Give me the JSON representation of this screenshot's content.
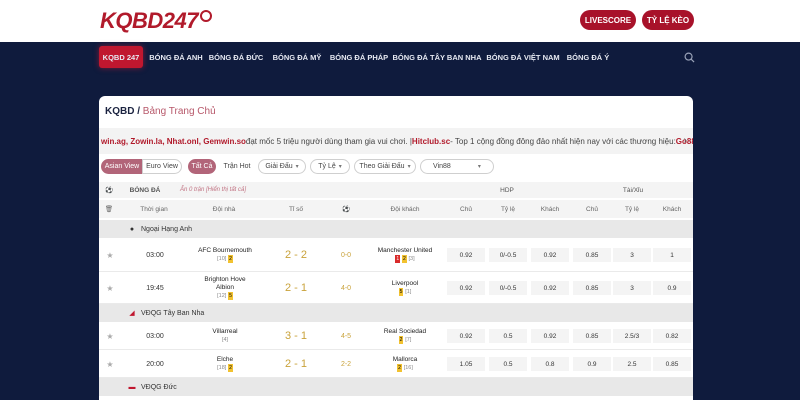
{
  "header": {
    "logo_text": "KQBD247",
    "livescore_label": "LIVESCORE",
    "odds_label": "TỶ LỆ KÈO"
  },
  "nav": {
    "items": [
      {
        "label": "KQBD 247"
      },
      {
        "label": "BÓNG ĐÁ ANH"
      },
      {
        "label": "BÓNG ĐÁ ĐỨC"
      },
      {
        "label": "BÓNG ĐÁ MỸ"
      },
      {
        "label": "BÓNG ĐÁ PHÁP"
      },
      {
        "label": "BÓNG ĐÁ TÂY BAN NHA"
      },
      {
        "label": "BÓNG ĐÁ VIỆT NAM"
      },
      {
        "label": "BÓNG ĐÁ Ý"
      }
    ]
  },
  "breadcrumb": {
    "root": "KQBD",
    "sep": " / ",
    "current": "Bảng Trang Chủ"
  },
  "ticker": {
    "brands": "win.ag, Zowin.la, Nhat.onl, Gemwin.so",
    "text1": " đạt mốc 5 triệu người dùng tham gia vui chơi. | ",
    "brand2": "Hitclub.sc",
    "text2": " - Top 1 cộng đồng đông đảo nhất hiện nay với các thương hiệu: ",
    "brand3": "Go88.l",
    "arrow": "›"
  },
  "filters": {
    "asian_view": "Asian View",
    "euro_view": "Euro View",
    "all": "Tất Cả",
    "hot": "Trận Hot",
    "league": "Giải Đấu",
    "odds_type": "Tỷ Lệ",
    "by_league": "Theo Giải Đấu",
    "bookmaker": "Vin88"
  },
  "table": {
    "sport_label": "BÓNG ĐÁ",
    "hidden_note": "Ẩn 0 trận [Hiển thị tất cả]",
    "hdp": "HDP",
    "taixiu": "Tài/Xỉu",
    "columns": [
      "Thời gian",
      "Đội nhà",
      "Tỉ số",
      "Đội khách",
      "Chủ",
      "Tỷ lệ",
      "Khách",
      "Chủ",
      "Tỷ lệ",
      "Khách"
    ],
    "leagues": [
      {
        "name": "Ngoại Hạng Anh"
      },
      {
        "name": "VĐQG Tây Ban Nha"
      },
      {
        "name": "VĐQG Đức"
      }
    ],
    "matches": [
      {
        "time": "03:00",
        "home": "AFC Bournemouth",
        "home_rank": "[10]",
        "home_card": "2",
        "score": "2 - 2",
        "ht": "0-0",
        "away": "Manchester United",
        "away_rank": "[3]",
        "away_red": "1",
        "away_yellow": "2",
        "hdp_home": "0.92",
        "hdp_line": "0/-0.5",
        "hdp_away": "0.92",
        "ou_over": "0.85",
        "ou_line": "3",
        "ou_under": "1"
      },
      {
        "time": "19:45",
        "home": "Brighton Hove Albion",
        "home_rank": "[12]",
        "home_card": "5",
        "score": "2 - 1",
        "ht": "4-0",
        "away": "Liverpool",
        "away_rank": "[1]",
        "away_card": "5",
        "hdp_home": "0.92",
        "hdp_line": "0/-0.5",
        "hdp_away": "0.92",
        "ou_over": "0.85",
        "ou_line": "3",
        "ou_under": "0.9"
      },
      {
        "time": "03:00",
        "home": "Villarreal",
        "home_rank": "[4]",
        "score": "3 - 1",
        "ht": "4-5",
        "away": "Real Sociedad",
        "away_rank": "[7]",
        "away_card": "2",
        "hdp_home": "0.92",
        "hdp_line": "0.5",
        "hdp_away": "0.92",
        "ou_over": "0.85",
        "ou_line": "2.5/3",
        "ou_under": "0.82"
      },
      {
        "time": "20:00",
        "home": "Elche",
        "home_rank": "[18]",
        "home_card": "2",
        "score": "2 - 1",
        "ht": "2-2",
        "away": "Mallorca",
        "away_rank": "[16]",
        "away_card": "2",
        "hdp_home": "1.05",
        "hdp_line": "0.5",
        "hdp_away": "0.8",
        "ou_over": "0.9",
        "ou_line": "2.5",
        "ou_under": "0.85"
      }
    ]
  },
  "colors": {
    "navy": "#0f1b3d",
    "red": "#a8122a",
    "gold": "#c9a23a"
  }
}
